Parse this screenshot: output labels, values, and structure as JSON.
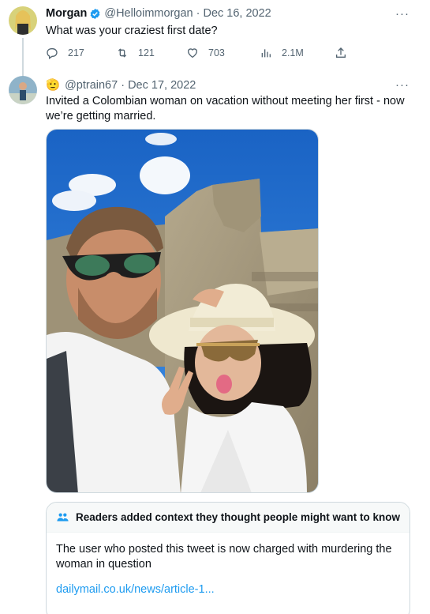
{
  "tweet1": {
    "display_name": "Morgan",
    "handle": "@Helloimmorgan",
    "date": "Dec 16, 2022",
    "text": "What was your craziest first date?",
    "more": "···",
    "actions": {
      "replies": "217",
      "retweets": "121",
      "likes": "703",
      "views": "2.1M"
    }
  },
  "tweet2": {
    "emoji": "🫡",
    "handle": "@ptrain67",
    "date": "Dec 17, 2022",
    "more": "···",
    "text_line1": "Invited a Colombian woman on vacation without meeting her first - now",
    "text_line2": "we’re getting married."
  },
  "community_note": {
    "header": "Readers added context they thought people might want to know",
    "body_line1": "The user who posted this tweet is now charged with murdering the",
    "body_line2": "woman in question",
    "link": "dailymail.co.uk/news/article-1..."
  },
  "colors": {
    "accent": "#1d9bf0",
    "muted": "#536471",
    "border": "#cfd9de"
  },
  "icons": [
    "reply-icon",
    "retweet-icon",
    "like-icon",
    "views-icon",
    "share-icon",
    "verified-badge-icon",
    "more-icon",
    "people-icon"
  ]
}
